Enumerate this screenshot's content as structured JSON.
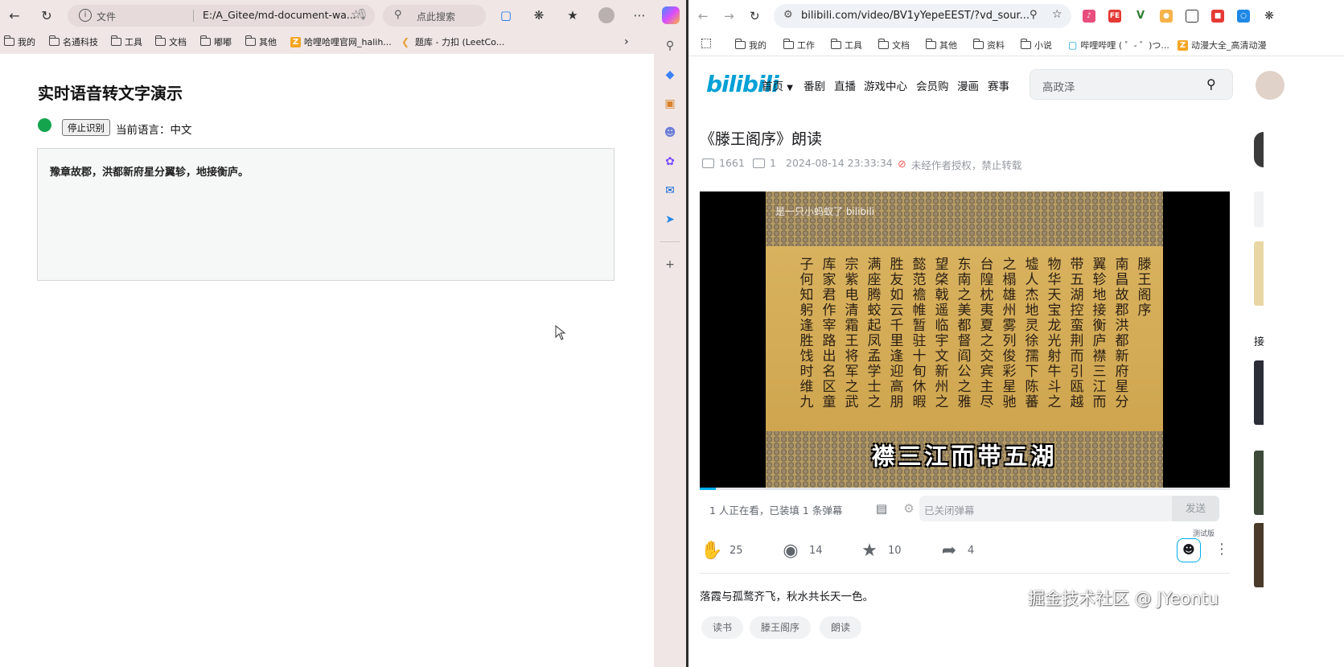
{
  "left": {
    "address": {
      "protocol_label": "文件",
      "url": "E:/A_Gitee/md-document-wa..."
    },
    "search": {
      "placeholder": "点此搜索"
    },
    "bookmarks": [
      {
        "label": "我的",
        "icon": "folder-icon"
      },
      {
        "label": "名通科技",
        "icon": "folder-icon"
      },
      {
        "label": "工具",
        "icon": "folder-icon"
      },
      {
        "label": "文档",
        "icon": "folder-icon"
      },
      {
        "label": "嘟嘟",
        "icon": "folder-icon"
      },
      {
        "label": "其他",
        "icon": "folder-icon"
      },
      {
        "label": "哈哩哈哩官网_halih...",
        "icon": "z-favicon"
      },
      {
        "label": "题库 - 力扣 (LeetCo...",
        "icon": "leetcode-favicon"
      }
    ],
    "page": {
      "heading": "实时语音转文字演示",
      "stop_button": "停止识别",
      "language_label": "当前语言：中文",
      "transcript": "豫章故郡，洪都新府星分翼轸，地接衡庐。",
      "status_color": "#14a44d"
    }
  },
  "right": {
    "address": {
      "url": "bilibili.com/video/BV1yYepeEEST/?vd_sour..."
    },
    "bookmarks": [
      {
        "label": "我的",
        "icon": "folder-icon"
      },
      {
        "label": "工作",
        "icon": "folder-icon"
      },
      {
        "label": "工具",
        "icon": "folder-icon"
      },
      {
        "label": "文档",
        "icon": "folder-icon"
      },
      {
        "label": "其他",
        "icon": "folder-icon"
      },
      {
        "label": "资料",
        "icon": "folder-icon"
      },
      {
        "label": "小说",
        "icon": "folder-icon"
      },
      {
        "label": "哔哩哔哩 ( ゜- ゜)つ...",
        "icon": "bilibili-favicon"
      },
      {
        "label": "动漫大全_高清动漫",
        "icon": "anime-favicon"
      }
    ],
    "site": {
      "logo": "bilibili",
      "nav": [
        "首页",
        "番剧",
        "直播",
        "游戏中心",
        "会员购",
        "漫画",
        "赛事"
      ],
      "search_placeholder": "高政泽",
      "accent_color": "#00aeec"
    },
    "video": {
      "title": "《滕王阁序》朗读",
      "views": "1661",
      "danmaku_count": "1",
      "publish_time": "2024-08-14 23:33:34",
      "copyright_notice": "未经作者授权，禁止转载",
      "frame_watermark": "是一只小蚂蚁了 bilibili",
      "subtitle": "襟三江而带五湖",
      "progress": 0.03,
      "calligraphy_columns": [
        "滕王阁序",
        "南昌故郡洪都新府星分",
        "翼轸地接衡庐襟三江而",
        "带五湖控蛮荆而引瓯越",
        "物华天宝龙光射牛斗之",
        "墟人杰地灵徐孺下陈蕃",
        "之榻雄州雾列俊彩星驰",
        "台隍枕夷夏之交宾主尽",
        "东南之美都督阎公之雅",
        "望棨戟遥临宇文新州之",
        "懿范襜帷暂驻十旬休暇",
        "胜友如云千里逢迎高朋",
        "满座腾蛟起凤孟学士之词",
        "宗紫电清霜王将军之武",
        "库家君作宰路出名区童",
        "子何知躬逢胜饯时维九月"
      ]
    },
    "danmaku_bar": {
      "viewers_text": "1 人正在看，已装填 1 条弹幕",
      "input_placeholder": "已关闭弹幕",
      "send_label": "发送"
    },
    "actions": {
      "like": "25",
      "coin": "14",
      "favorite": "10",
      "share": "4",
      "beta_label": "测试版"
    },
    "description": "落霞与孤鹜齐飞，秋水共长天一色。",
    "tags": [
      "读书",
      "滕王阁序",
      "朗读"
    ],
    "right_column_label": "接",
    "site_watermark": "掘金技术社区 @ JYeontu"
  }
}
